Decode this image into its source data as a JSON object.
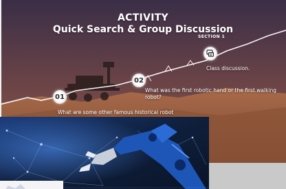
{
  "slide": {
    "title": "ACTIVITY",
    "subtitle": "Quick Search & Group Discussion",
    "section": "SECTION 1"
  },
  "steps": [
    {
      "badge": "01",
      "text": "What are some other famous historical robot"
    },
    {
      "badge": "02",
      "text": "What was the first robotic hand or the first walking robot?"
    },
    {
      "badge": "",
      "text": "Class discussion.",
      "icon": "discussion-icon"
    }
  ],
  "colors": {
    "sky_top": "#3a2e47",
    "sky_mid": "#7e4a43",
    "mars_ground": "#a86a4a",
    "accent_white": "#ffffff",
    "robot_blue": "#1e56b8",
    "photo_bg": "#0f1f3c",
    "gray_panel": "#c9c9c9"
  }
}
